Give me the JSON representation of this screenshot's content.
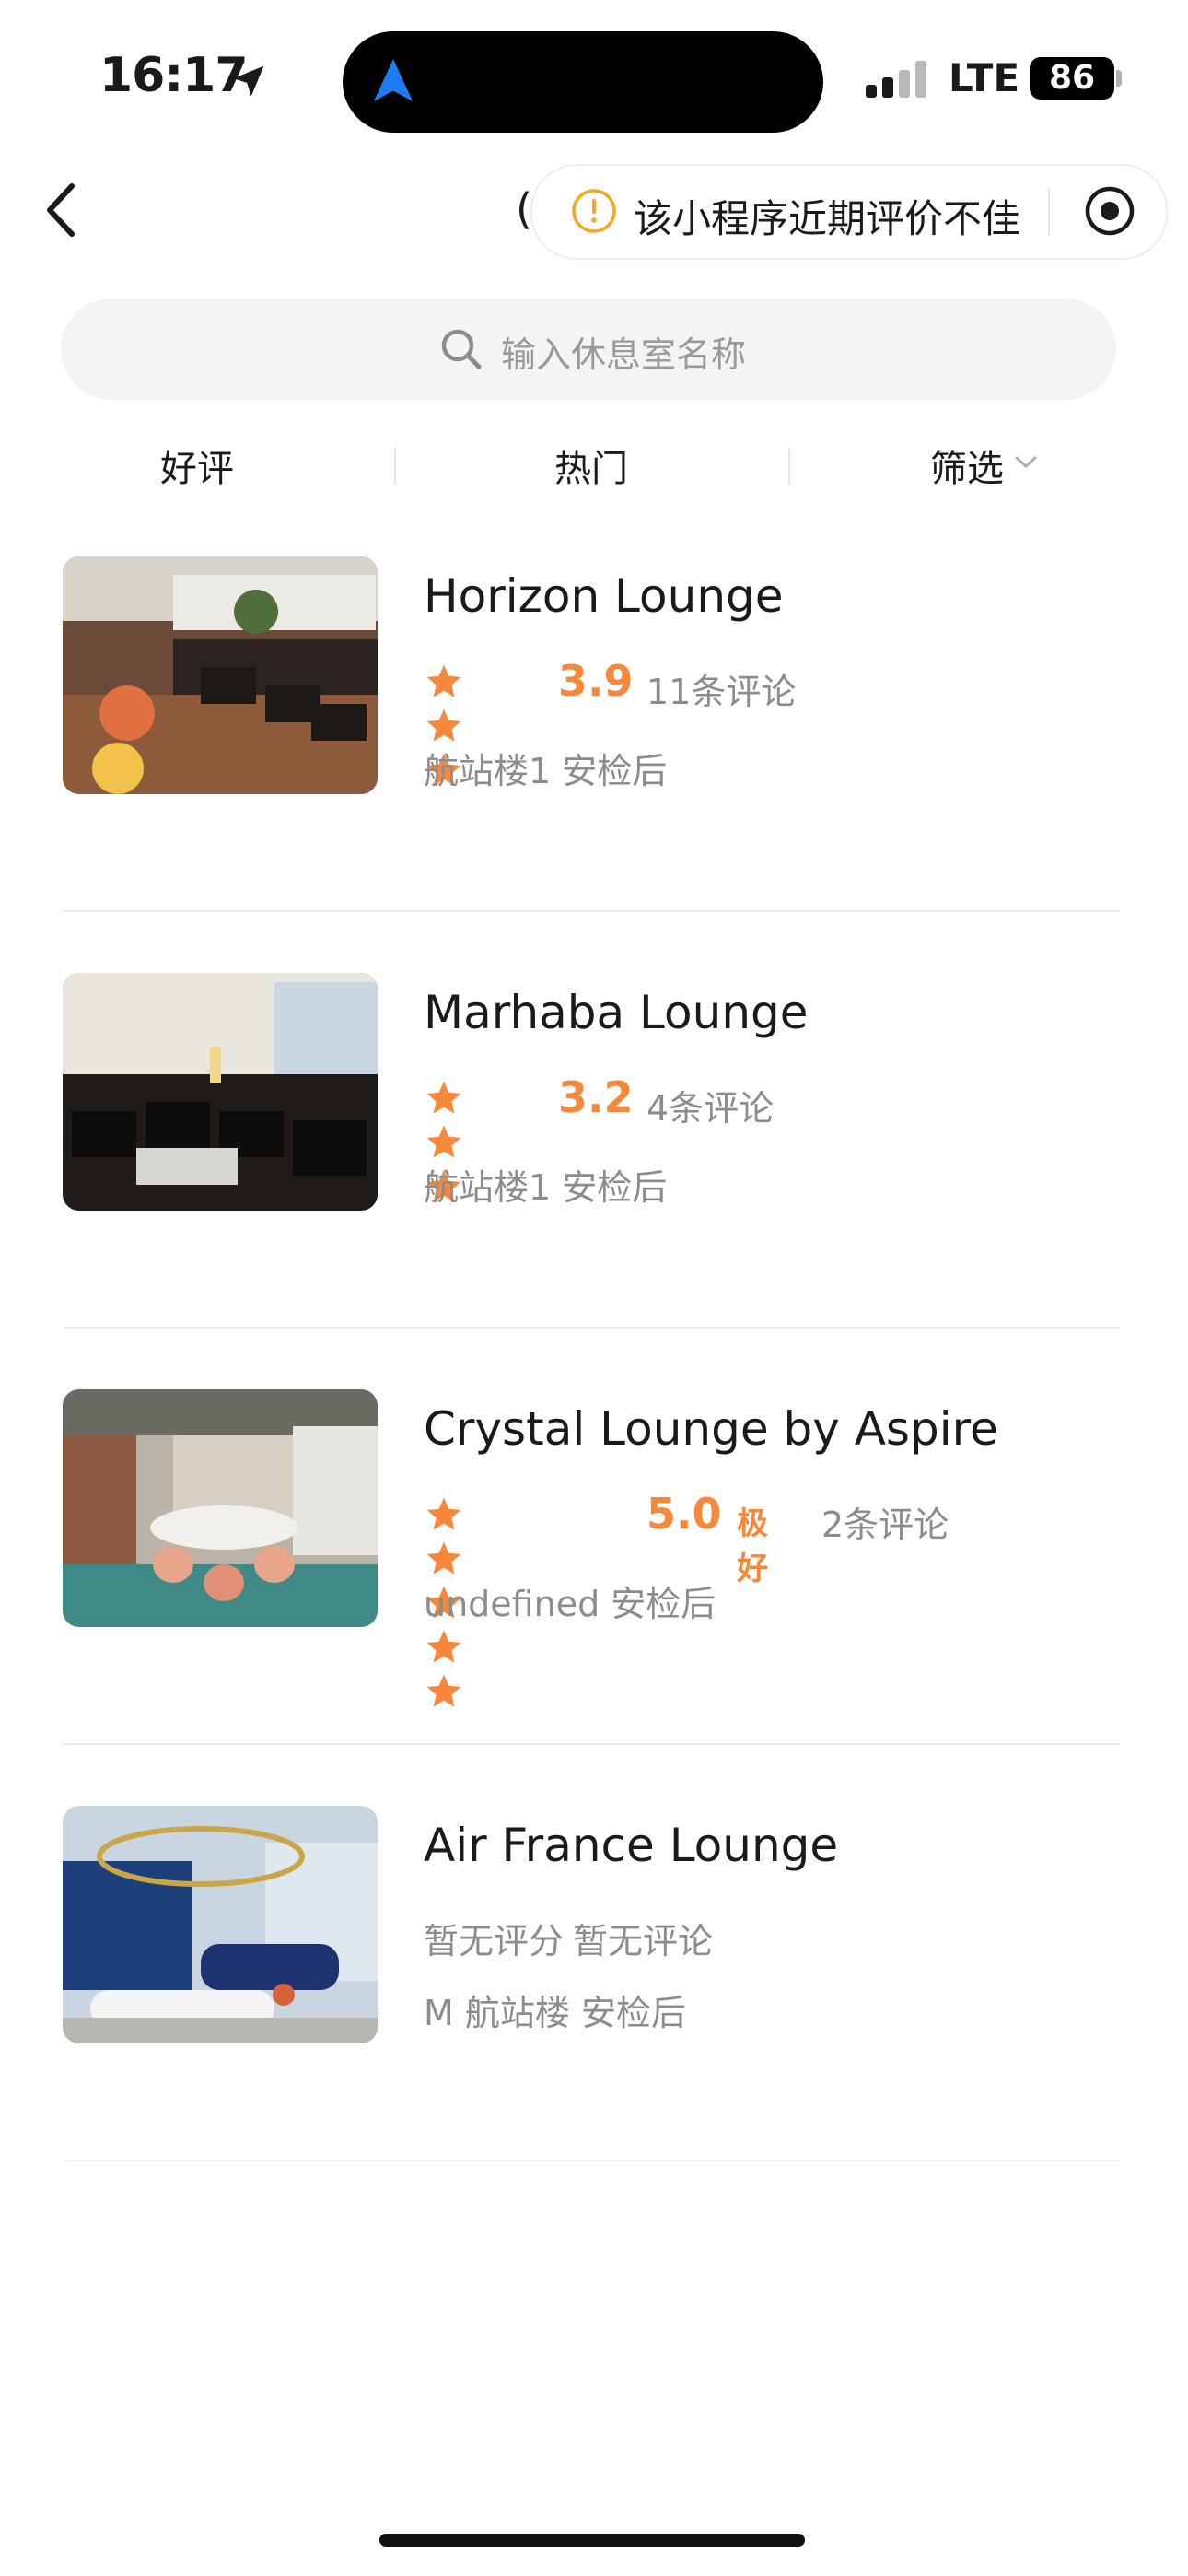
{
  "status_bar": {
    "time": "16:17",
    "network": "LTE",
    "battery": "86"
  },
  "nav": {
    "title_fragment": "(",
    "capsule_notice": "该小程序近期评价不佳"
  },
  "search": {
    "placeholder": "输入休息室名称"
  },
  "tabs": [
    {
      "label": "好评"
    },
    {
      "label": "热门"
    },
    {
      "label": "筛选"
    }
  ],
  "lounges": [
    {
      "name": "Horizon Lounge",
      "stars": 3,
      "score": "3.9",
      "badge": "",
      "reviews": "11条评论",
      "location": "航站楼1 安检后"
    },
    {
      "name": "Marhaba Lounge",
      "stars": 3,
      "score": "3.2",
      "badge": "",
      "reviews": "4条评论",
      "location": "航站楼1 安检后"
    },
    {
      "name": "Crystal Lounge by Aspire",
      "stars": 5,
      "score": "5.0",
      "badge": "极好",
      "reviews": "2条评论",
      "location": "undefined 安检后"
    },
    {
      "name": "Air France Lounge",
      "no_score": "暂无评分",
      "no_reviews": "暂无评论",
      "location": "M 航站楼 安检后"
    }
  ],
  "colors": {
    "accent": "#f5883a",
    "muted": "#8c8c8c",
    "search_bg": "#f4f4f4",
    "separator": "#ededed"
  }
}
